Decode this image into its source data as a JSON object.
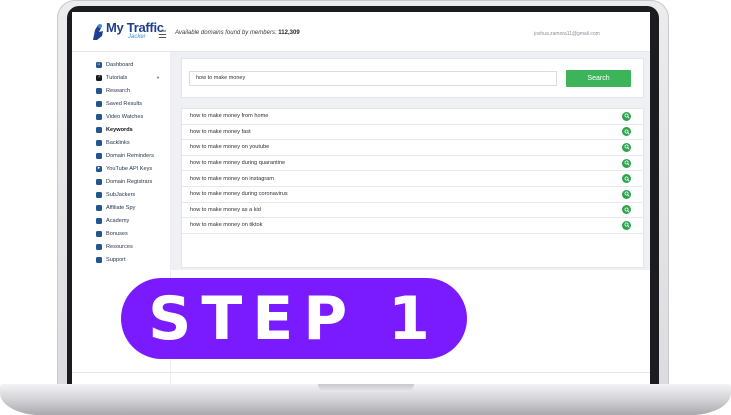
{
  "app": {
    "logo_main": "My Traffic",
    "logo_sub": "Jacker"
  },
  "header": {
    "available_label": "Available domains found by members:",
    "available_count": "112,309",
    "user_email": "joshua.zamora11@gmail.com"
  },
  "sidebar": {
    "items": [
      {
        "label": "Dashboard",
        "icon": "home-icon"
      },
      {
        "label": "Tutorials",
        "icon": "question-icon"
      },
      {
        "label": "Research",
        "icon": "search-icon"
      },
      {
        "label": "Saved Results",
        "icon": "save-icon"
      },
      {
        "label": "Video Watches",
        "icon": "video-icon"
      },
      {
        "label": "Keywords",
        "icon": "key-icon"
      },
      {
        "label": "Backlinks",
        "icon": "link-icon"
      },
      {
        "label": "Domain Reminders",
        "icon": "bell-icon"
      },
      {
        "label": "YouTube API Keys",
        "icon": "youtube-icon"
      },
      {
        "label": "Domain Registrars",
        "icon": "globe-icon"
      },
      {
        "label": "SubJackers",
        "icon": "users-icon"
      },
      {
        "label": "Affiliate Spy",
        "icon": "spy-icon"
      },
      {
        "label": "Academy",
        "icon": "graduation-icon"
      },
      {
        "label": "Bonuses",
        "icon": "gift-icon"
      },
      {
        "label": "Resources",
        "icon": "folder-icon"
      },
      {
        "label": "Support",
        "icon": "megaphone-icon"
      }
    ]
  },
  "search": {
    "value": "how to make money",
    "button_label": "Search"
  },
  "results": [
    "how to make money from home",
    "how to make money fast",
    "how to make money on youtube",
    "how to make money during quarantine",
    "how to make money on instagram",
    "how to make money during coronavirus",
    "how to make money as a kid",
    "how to make money on tiktok"
  ],
  "banner": {
    "text": "STEP 1"
  },
  "colors": {
    "banner": "#7a1aff",
    "search_button": "#3cb45a",
    "result_icon": "#2aa34a",
    "brand": "#1f3f8f"
  }
}
